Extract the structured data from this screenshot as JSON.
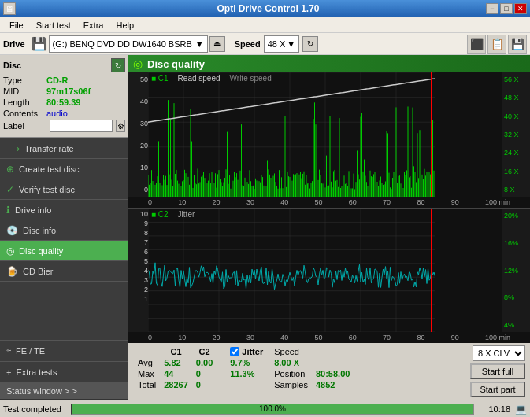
{
  "app": {
    "title": "Opti Drive Control 1.70",
    "title_bar_buttons": {
      "minimize": "−",
      "maximize": "□",
      "close": "✕"
    }
  },
  "menu": {
    "items": [
      "File",
      "Start test",
      "Extra",
      "Help"
    ]
  },
  "drive_bar": {
    "drive_label": "Drive",
    "drive_value": "(G:)  BENQ DVD DD DW1640 BSRB",
    "speed_label": "Speed",
    "speed_value": "48 X"
  },
  "disc": {
    "title": "Disc",
    "type_label": "Type",
    "type_value": "CD-R",
    "mid_label": "MID",
    "mid_value": "97m17s06f",
    "length_label": "Length",
    "length_value": "80:59.39",
    "contents_label": "Contents",
    "contents_value": "audio",
    "label_label": "Label",
    "label_value": ""
  },
  "sidebar": {
    "items": [
      {
        "id": "transfer-rate",
        "label": "Transfer rate",
        "icon": "⟶"
      },
      {
        "id": "create-test-disc",
        "label": "Create test disc",
        "icon": "⊕"
      },
      {
        "id": "verify-test-disc",
        "label": "Verify test disc",
        "icon": "✓"
      },
      {
        "id": "drive-info",
        "label": "Drive info",
        "icon": "ℹ"
      },
      {
        "id": "disc-info",
        "label": "Disc info",
        "icon": "💿"
      },
      {
        "id": "disc-quality",
        "label": "Disc quality",
        "icon": "◎",
        "active": true
      },
      {
        "id": "cd-bier",
        "label": "CD Bier",
        "icon": "🍺"
      }
    ],
    "fe_te": "FE / TE",
    "extra_tests": "Extra tests",
    "status_window": "Status window > >"
  },
  "disc_quality": {
    "title": "Disc quality",
    "chart1": {
      "label": "C1",
      "legend": [
        {
          "label": "C1",
          "color": "#00aa00"
        },
        {
          "label": "Read speed",
          "color": "#cccccc"
        },
        {
          "label": "Write speed",
          "color": "#888888"
        }
      ],
      "y_left": [
        "50",
        "40",
        "30",
        "20",
        "10",
        "0"
      ],
      "y_right": [
        "56 X",
        "48 X",
        "40 X",
        "32 X",
        "24 X",
        "16 X",
        "8 X"
      ],
      "x_axis": [
        "0",
        "10",
        "20",
        "30",
        "40",
        "50",
        "60",
        "70",
        "80",
        "90",
        "100 min"
      ]
    },
    "chart2": {
      "label": "C2",
      "sublabel": "Jitter",
      "legend": [
        {
          "label": "C2",
          "color": "#00aa00"
        },
        {
          "label": "Jitter",
          "color": "#666666"
        }
      ],
      "y_left": [
        "10",
        "9",
        "8",
        "7",
        "6",
        "5",
        "4",
        "3",
        "2",
        "1"
      ],
      "y_right": [
        "20%",
        "16%",
        "12%",
        "8%",
        "4%"
      ],
      "x_axis": [
        "0",
        "10",
        "20",
        "30",
        "40",
        "50",
        "60",
        "70",
        "80",
        "90",
        "100 min"
      ]
    }
  },
  "stats": {
    "headers": [
      "",
      "C1",
      "C2",
      "",
      "Jitter",
      "Speed",
      ""
    ],
    "avg_label": "Avg",
    "avg_c1": "5.82",
    "avg_c2": "0.00",
    "avg_jitter": "9.7%",
    "max_label": "Max",
    "max_c1": "44",
    "max_c2": "0",
    "max_jitter": "11.3%",
    "total_label": "Total",
    "total_c1": "28267",
    "total_c2": "0",
    "speed_label": "Speed",
    "speed_value": "8.00 X",
    "position_label": "Position",
    "position_value": "80:58.00",
    "samples_label": "Samples",
    "samples_value": "4852",
    "speed_dropdown": "8 X CLV",
    "jitter_checked": true,
    "jitter_label": "Jitter",
    "start_full": "Start full",
    "start_part": "Start part"
  },
  "status_bar": {
    "text": "Test completed",
    "progress": 100,
    "progress_label": "100.0%",
    "time": "10:18"
  }
}
